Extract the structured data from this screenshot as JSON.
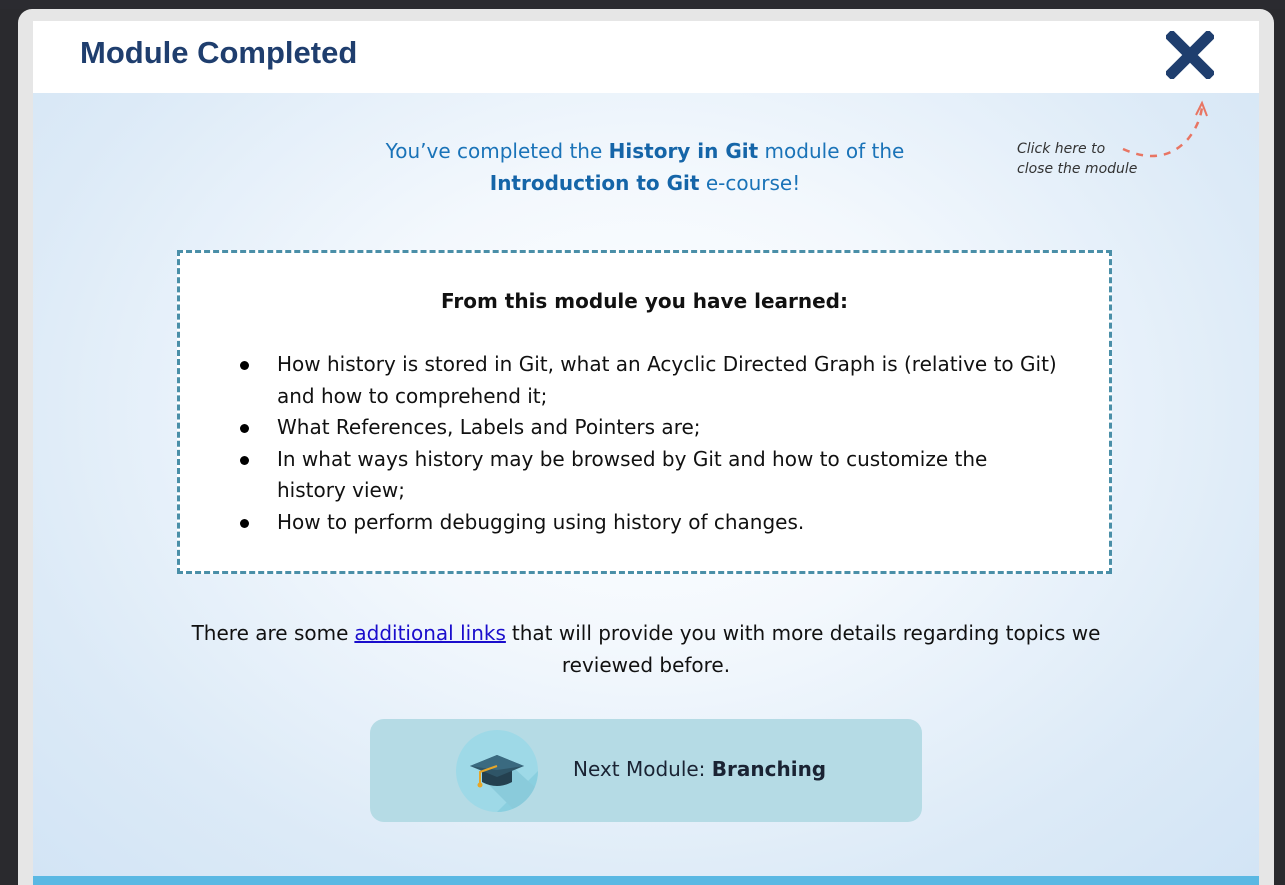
{
  "modal": {
    "title": "Module Completed",
    "close_hint_line1": "Click here to",
    "close_hint_line2": "close the module"
  },
  "intro": {
    "prefix": "You’ve completed the ",
    "module_name": "History in Git",
    "middle": " module of the",
    "course_name": "Introduction to Git",
    "suffix": " e-course!"
  },
  "learned": {
    "heading": "From this module you have learned:",
    "items": [
      "How history is stored in Git, what an Acyclic Directed Graph is (relative to Git) and how to comprehend it;",
      "What References, Labels and Pointers are;",
      "In what ways history may be browsed by Git and how to customize the history view;",
      "How to perform debugging using history of changes."
    ]
  },
  "more": {
    "prefix": "There are some",
    "link_text": "additional links",
    "suffix": "that will provide you with more details regarding topics we reviewed before."
  },
  "next_module": {
    "label_prefix": "Next Module: ",
    "name": "Branching"
  },
  "colors": {
    "title": "#1f3e6e",
    "close_icon": "#1f3e6e",
    "intro_text": "#1a73b8",
    "dashed_border": "#4a8fa8",
    "link": "#1a0dcc",
    "next_button_bg": "#b5dbe5",
    "bottom_bar": "#5ab8e3"
  },
  "icons": {
    "close": "close-x-icon",
    "next": "graduation-cap-icon"
  }
}
